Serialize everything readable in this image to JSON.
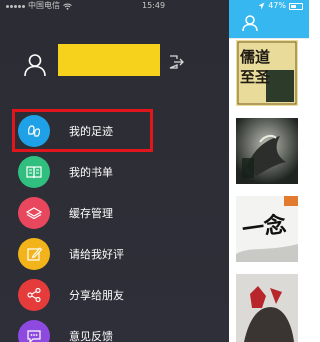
{
  "status_bar": {
    "carrier": "中国电信",
    "time": "15:49",
    "battery_percent": "47%",
    "battery_level": 0.47
  },
  "drawer": {
    "profile": {
      "avatar_icon": "user-outline-icon",
      "username": "",
      "username_highlight_color": "#f6d21c",
      "logout_icon": "logout-icon"
    },
    "menu": [
      {
        "label": "我的足迹",
        "icon": "footprint-icon",
        "color": "#1ea1e6"
      },
      {
        "label": "我的书单",
        "icon": "open-book-icon",
        "color": "#30bf7e"
      },
      {
        "label": "缓存管理",
        "icon": "cache-stack-icon",
        "color": "#e8475e"
      },
      {
        "label": "请给我好评",
        "icon": "edit-pencil-icon",
        "color": "#f3b31a"
      },
      {
        "label": "分享给朋友",
        "icon": "share-icon",
        "color": "#e53b3b"
      },
      {
        "label": "意见反馈",
        "icon": "feedback-chat-icon",
        "color": "#8d49e0"
      }
    ],
    "highlight_color": "#e0161c"
  },
  "shelf": {
    "header_color": "#36b7f0",
    "header_icon": "user-icon",
    "covers": [
      {
        "title": "儒道至圣",
        "subtitle": "",
        "theme": "yellow-calligraphy"
      },
      {
        "title": "",
        "subtitle": "",
        "theme": "dark-dragon"
      },
      {
        "title": "一念永恒",
        "subtitle": "",
        "theme": "ink-wash"
      },
      {
        "title": "",
        "subtitle": "",
        "theme": "red-warrior"
      }
    ]
  }
}
